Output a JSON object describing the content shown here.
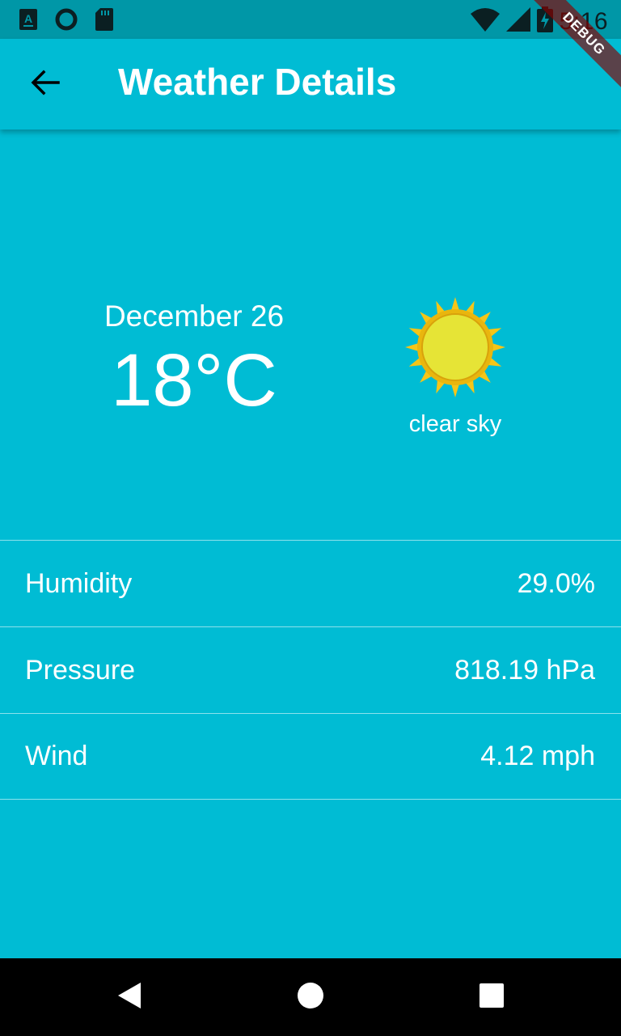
{
  "status_bar": {
    "time": "5:16",
    "icons": [
      "notification-a-icon",
      "sync-circle-icon",
      "sd-card-icon",
      "wifi-icon",
      "cell-signal-icon",
      "battery-charging-icon"
    ]
  },
  "app_bar": {
    "title": "Weather Details",
    "back_icon": "arrow-back-icon"
  },
  "debug_banner": "DEBUG",
  "weather": {
    "date": "December 26",
    "temperature": "18°C",
    "condition": "clear sky",
    "icon": "sun-icon"
  },
  "details": [
    {
      "label": "Humidity",
      "value": "29.0%"
    },
    {
      "label": "Pressure",
      "value": "818.19 hPa"
    },
    {
      "label": "Wind",
      "value": "4.12 mph"
    }
  ],
  "nav_bar": {
    "icons": [
      "back-triangle-icon",
      "home-circle-icon",
      "recents-square-icon"
    ]
  },
  "colors": {
    "background": "#00BCD4",
    "status_bar": "#0097A7",
    "text": "#FFFFFF",
    "nav_bar": "#000000"
  }
}
